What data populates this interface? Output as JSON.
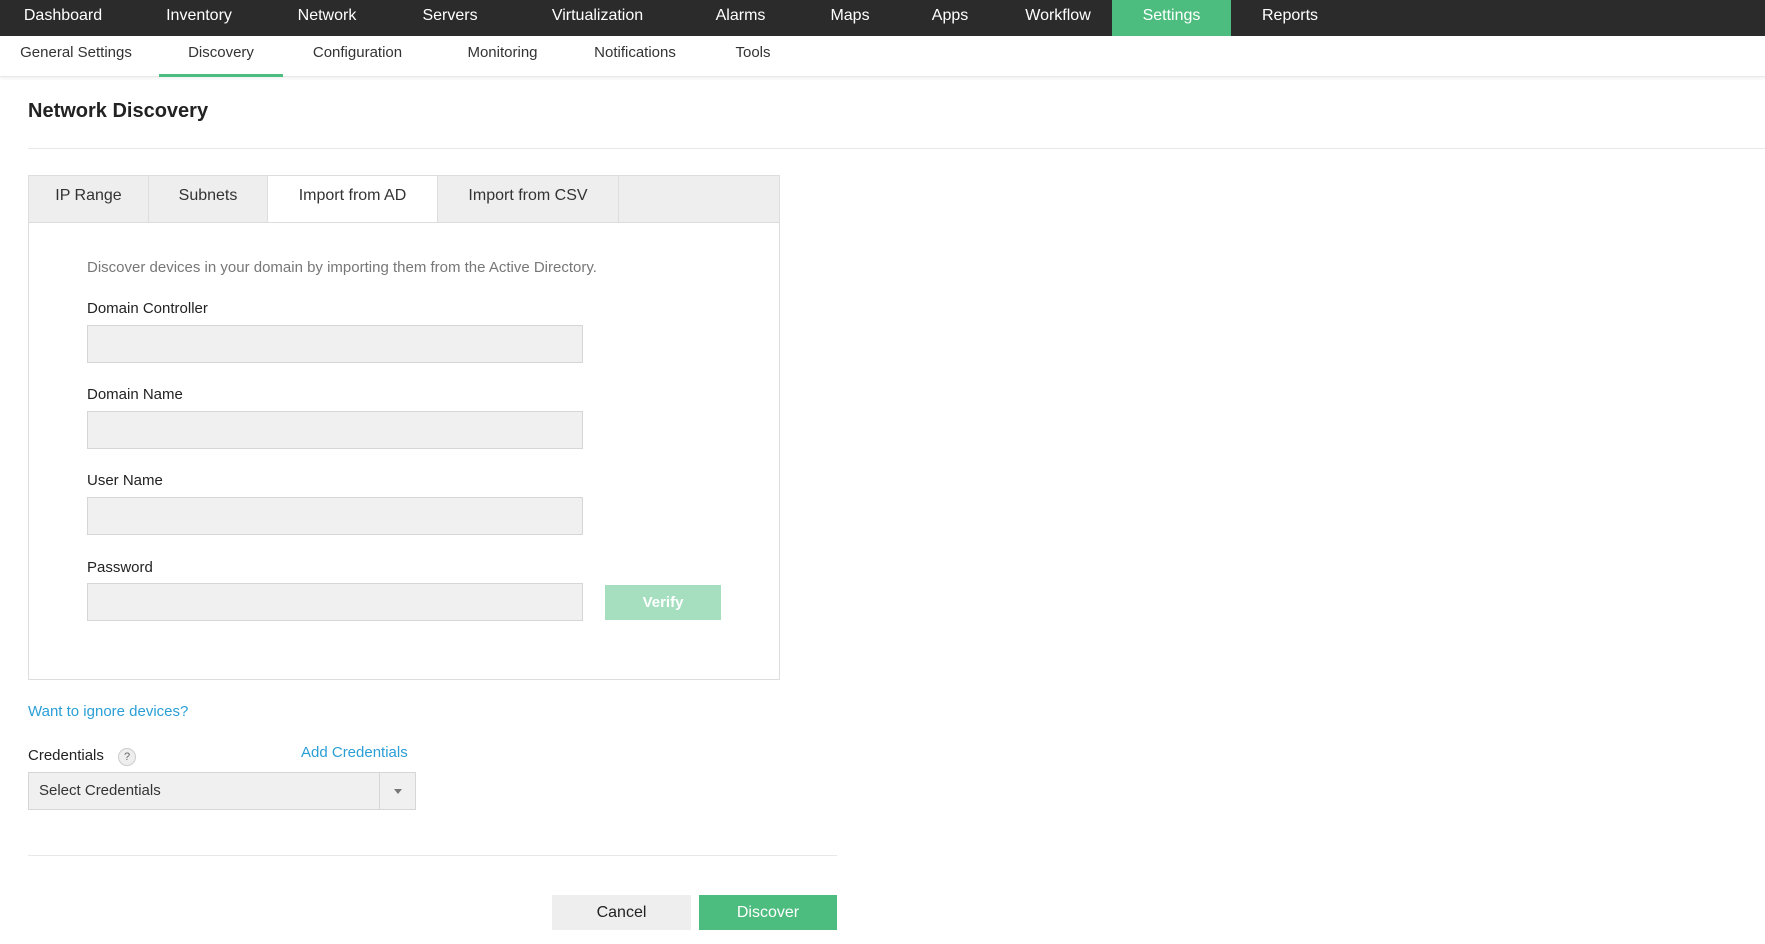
{
  "topnav": {
    "items": [
      "Dashboard",
      "Inventory",
      "Network",
      "Servers",
      "Virtualization",
      "Alarms",
      "Maps",
      "Apps",
      "Workflow",
      "Settings",
      "Reports"
    ],
    "active": "Settings"
  },
  "subnav": {
    "items": [
      "General Settings",
      "Discovery",
      "Configuration",
      "Monitoring",
      "Notifications",
      "Tools"
    ],
    "active": "Discovery"
  },
  "page": {
    "title": "Network Discovery"
  },
  "tabs": {
    "items": [
      "IP Range",
      "Subnets",
      "Import from AD",
      "Import from CSV"
    ],
    "active": "Import from AD"
  },
  "form": {
    "description": "Discover devices in your domain by importing them from the Active Directory.",
    "domain_controller_label": "Domain Controller",
    "domain_controller_value": "",
    "domain_name_label": "Domain Name",
    "domain_name_value": "",
    "user_name_label": "User Name",
    "user_name_value": "",
    "password_label": "Password",
    "password_value": "",
    "verify_label": "Verify"
  },
  "links": {
    "ignore_devices": "Want to ignore devices?",
    "add_credentials": "Add Credentials"
  },
  "credentials": {
    "label": "Credentials",
    "help_glyph": "?",
    "selected": "Select Credentials"
  },
  "actions": {
    "cancel_label": "Cancel",
    "discover_label": "Discover"
  },
  "colors": {
    "accent": "#4dbd7f",
    "topnav_bg": "#2b2b2b",
    "link": "#2a9fd6",
    "verify_disabled": "#a5dfbf"
  }
}
